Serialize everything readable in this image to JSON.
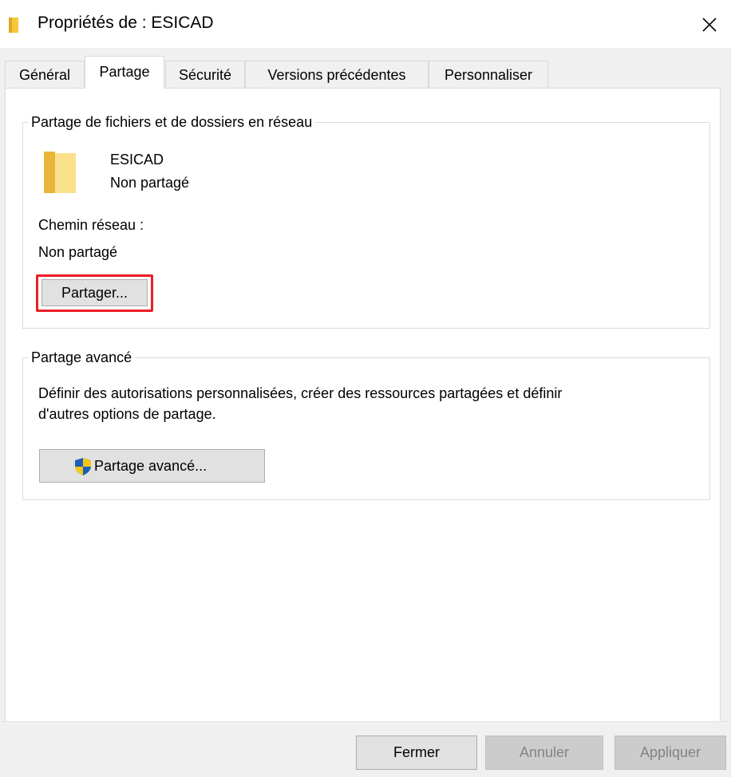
{
  "window": {
    "title": "Propriétés de : ESICAD",
    "icons": {
      "title": "folder-icon",
      "close": "close-icon"
    }
  },
  "tabs": [
    {
      "label": "Général"
    },
    {
      "label": "Partage",
      "active": true
    },
    {
      "label": "Sécurité"
    },
    {
      "label": "Versions précédentes"
    },
    {
      "label": "Personnaliser"
    }
  ],
  "network_sharing": {
    "legend": "Partage de fichiers et de dossiers en réseau",
    "folder_name": "ESICAD",
    "folder_status": "Non partagé",
    "network_path_label": "Chemin réseau :",
    "network_path_value": "Non partagé",
    "share_button": "Partager...",
    "highlight_color": "#ee1d23"
  },
  "advanced_sharing": {
    "legend": "Partage avancé",
    "description_line1": "Définir des autorisations personnalisées, créer des ressources partagées et définir",
    "description_line2": "d'autres options de partage.",
    "button": "Partage avancé...",
    "button_icon": "uac-shield-icon"
  },
  "footer": {
    "close_button": "Fermer",
    "cancel_button": "Annuler",
    "apply_button": "Appliquer"
  }
}
